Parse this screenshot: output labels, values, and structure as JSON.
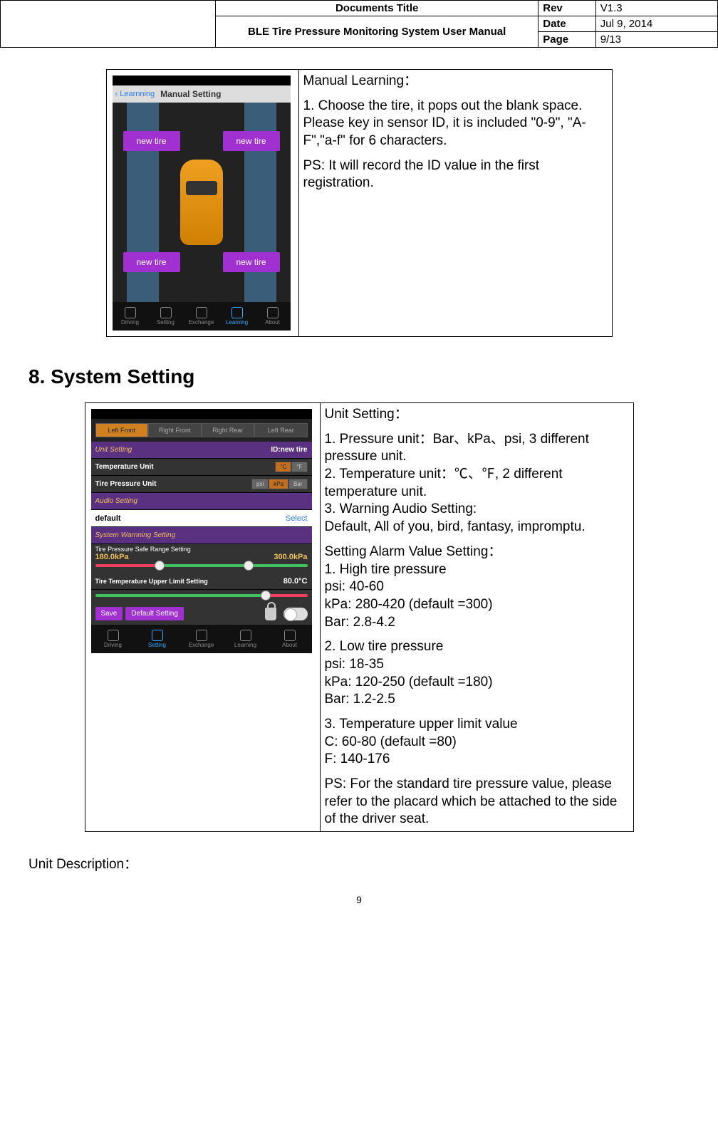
{
  "header": {
    "docTitleLabel": "Documents Title",
    "docTitle": "BLE Tire Pressure Monitoring System User Manual",
    "revLabel": "Rev",
    "rev": "V1.3",
    "dateLabel": "Date",
    "date": "Jul 9, 2014",
    "pageLabel": "Page",
    "page": "9/13"
  },
  "manualLearning": {
    "nav_back": "Learnning",
    "nav_title": "Manual Setting",
    "tire_label": "new tire",
    "desc_title": "Manual  Learning：",
    "step1": "1.  Choose the tire, it pops out the blank space. Please key in sensor ID, it is included \"0-9\", \"A-F\",\"a-f\" for 6 characters.",
    "ps": "PS: It will record the ID value in the first registration."
  },
  "sectionHeading": "8. System Setting",
  "systemSetting": {
    "tabs": [
      "Left Front",
      "Right Front",
      "Right Rear",
      "Left Rear"
    ],
    "unitSettingLabel": "Unit Setting",
    "idLabel": "ID:new tire",
    "tempUnitLabel": "Temperature Unit",
    "tempUnits": [
      "°C",
      "°F"
    ],
    "pressUnitLabel": "Tire Pressure Unit",
    "pressUnits": [
      "psi",
      "kPa",
      "Bar"
    ],
    "audioLabel": "Audio Setting",
    "defaultLabel": "default",
    "selectLabel": "Select",
    "warnLabel": "System Warnning Setting",
    "rangeLabel": "Tire Pressure Safe Range Setting",
    "lowVal": "180.0kPa",
    "highVal": "300.0kPa",
    "tempLimitLabel": "Tire Temperature Upper Limit Setting",
    "tempLimitVal": "80.0°C",
    "saveLabel": "Save",
    "defaultBtnLabel": "Default Setting",
    "desc_title": "Unit Setting：",
    "item1": "1. Pressure unit：Bar、kPa、psi, 3 different pressure unit.",
    "item2": "2. Temperature unit：℃、℉, 2 different temperature unit.",
    "item3": "3. Warning Audio Setting:",
    "item3b": "Default, All of you, bird, fantasy, impromptu.",
    "alarm_title": "Setting Alarm Value Setting：",
    "a1": "1. High tire pressure",
    "a1_psi": "psi:   40-60",
    "a1_kpa": "kPa:  280-420 (default =300)",
    "a1_bar": "Bar:   2.8-4.2",
    "a2": "2. Low tire pressure",
    "a2_psi": "psi:   18-35",
    "a2_kpa": "kPa:  120-250  (default =180)",
    "a2_bar": "Bar:   1.2-2.5",
    "a3": "3. Temperature upper limit value",
    "a3_c": "C:  60-80 (default =80)",
    "a3_f": "F:  140-176",
    "ps": "PS: For the standard tire pressure value, please refer to the placard which be attached to the side of the driver seat."
  },
  "unitDescription": "Unit Description：",
  "pageNumber": "9",
  "tabBar": [
    "Driving",
    "Setting",
    "Exchange",
    "Learning",
    "About"
  ]
}
